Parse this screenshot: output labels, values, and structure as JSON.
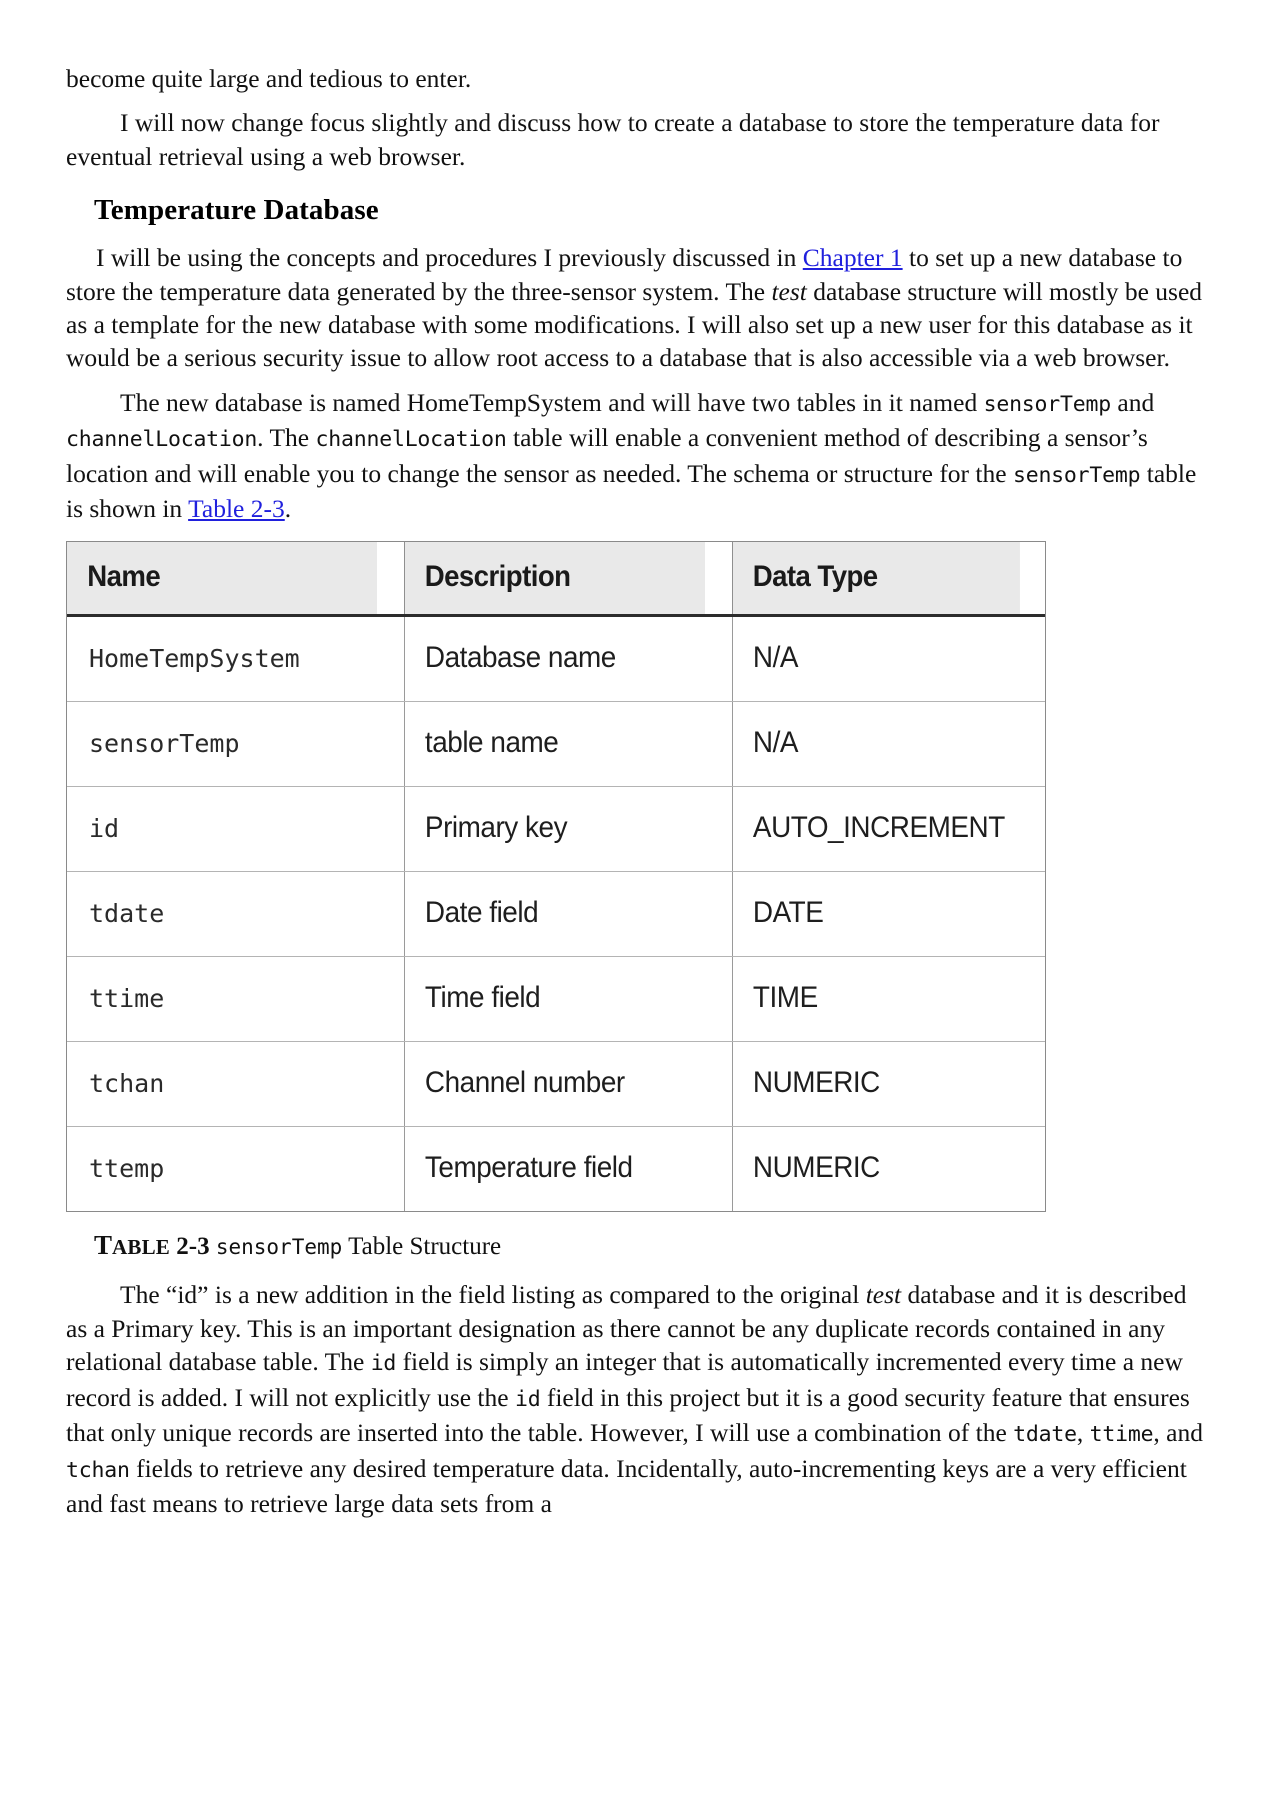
{
  "document": {
    "top_paragraph": "become quite large and tedious to enter.",
    "intro_paragraph": "I will now change focus slightly and discuss how to create a database to store the temperature data for eventual retrieval using a web browser.",
    "section_heading": "Temperature Database",
    "paragraph_2": {
      "part1": "I will be using the concepts and procedures I previously discussed in ",
      "link": "Chapter 1",
      "part2": " to set up a new database to store the temperature data generated by the three-sensor system. The ",
      "italic1": "test",
      "part3": " database structure will mostly be used as a template for the new database with some modifications. I will also set up a new user for this database as it would be a serious security issue to allow root access to a database that is also accessible via a web browser."
    },
    "paragraph_3": {
      "part1": "The new database is named HomeTempSystem and will have two tables in it named ",
      "mono1": "sensorTemp",
      "part2": " and ",
      "mono2": "channelLocation",
      "part3": ". The ",
      "mono3": "channelLocation",
      "part4": " table will enable a convenient method of describing a sensor’s location and will enable you to change the sensor as needed. The schema or structure for the ",
      "mono4": "sensorTemp",
      "part5": " table is shown in ",
      "link": "Table 2-3",
      "part6": "."
    },
    "paragraph_4": {
      "part1": "The “id” is a new addition in the field listing as compared to the original ",
      "italic1": "test",
      "part2": " database and it is described as a Primary key. This is an important designation as there cannot be any duplicate records contained in any relational database table. The ",
      "mono1": "id",
      "part3": " field is simply an integer that is automatically incremented every time a new record is added. I will not explicitly use the ",
      "mono2": "id",
      "part4": " field in this project but it is a good security feature that ensures that only unique records are inserted into the table. However, I will use a combination of the ",
      "mono3": "tdate",
      "part5": ", ",
      "mono4": "ttime",
      "part6": ", and ",
      "mono5": "tchan",
      "part7": " fields to retrieve any desired temperature data. Incidentally, auto-incrementing keys are a very efficient and fast means to retrieve large data sets from a"
    },
    "caption": {
      "label_first": "T",
      "label_rest": "ABLE",
      "label_number": "2-3",
      "mono": "sensorTemp",
      "suffix": "Table Structure"
    }
  },
  "table": {
    "headers": [
      "Name",
      "Description",
      "Data Type"
    ],
    "rows": [
      {
        "name": "HomeTempSystem",
        "description": "Database name",
        "data_type": "N/A"
      },
      {
        "name": "sensorTemp",
        "description": "table name",
        "data_type": "N/A"
      },
      {
        "name": "id",
        "description": "Primary key",
        "data_type": "AUTO_INCREMENT"
      },
      {
        "name": "tdate",
        "description": "Date field",
        "data_type": "DATE"
      },
      {
        "name": "ttime",
        "description": "Time field",
        "data_type": "TIME"
      },
      {
        "name": "tchan",
        "description": "Channel number",
        "data_type": "NUMERIC"
      },
      {
        "name": "ttemp",
        "description": "Temperature field",
        "data_type": "NUMERIC"
      }
    ]
  },
  "colors": {
    "link": "#2020dd",
    "header_bg": "#e9e9e9",
    "text": "#111111"
  }
}
